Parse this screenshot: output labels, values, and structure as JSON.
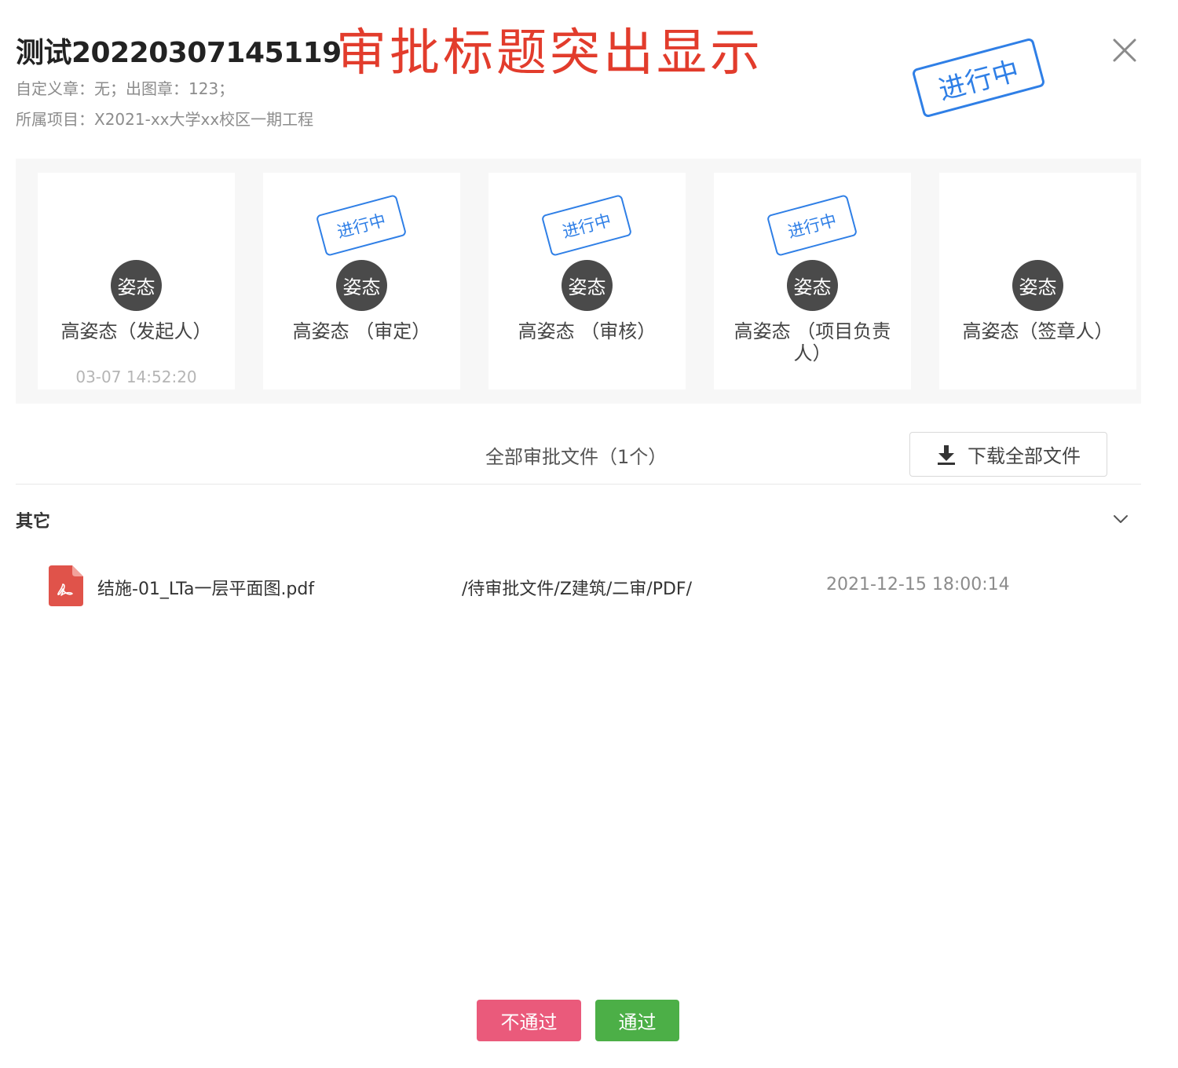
{
  "header": {
    "title": "测试20220307145119",
    "annotation": "审批标题突出显示",
    "meta_line1": "自定义章：无；出图章：123；",
    "meta_line2": "所属项目：X2021-xx大学xx校区一期工程",
    "status_stamp": "进行中"
  },
  "flow": {
    "steps": [
      {
        "avatar": "姿态",
        "name": "高姿态（发起人）",
        "time": "03-07 14:52:20",
        "stamp": ""
      },
      {
        "avatar": "姿态",
        "name": "高姿态 （审定）",
        "time": "",
        "stamp": "进行中"
      },
      {
        "avatar": "姿态",
        "name": "高姿态 （审核）",
        "time": "",
        "stamp": "进行中"
      },
      {
        "avatar": "姿态",
        "name": "高姿态 （项目负责人）",
        "time": "",
        "stamp": "进行中"
      },
      {
        "avatar": "姿态",
        "name": "高姿态（签章人）",
        "time": "",
        "stamp": ""
      }
    ]
  },
  "files": {
    "header": "全部审批文件（1个）",
    "download_label": "下载全部文件",
    "group_title": "其它",
    "items": [
      {
        "name": "结施-01_LTa一层平面图.pdf",
        "path": "/待审批文件/Z建筑/二审/PDF/",
        "time": "2021-12-15 18:00:14"
      }
    ]
  },
  "actions": {
    "reject_label": "不通过",
    "approve_label": "通过"
  },
  "colors": {
    "annotation": "#e23c2c",
    "stamp": "#2f7fe6",
    "reject": "#ea5a7b",
    "approve": "#4caf47",
    "pdf": "#e0534a"
  },
  "icons": [
    "close-icon",
    "download-icon",
    "chevron-down-icon",
    "pdf-file-icon"
  ]
}
